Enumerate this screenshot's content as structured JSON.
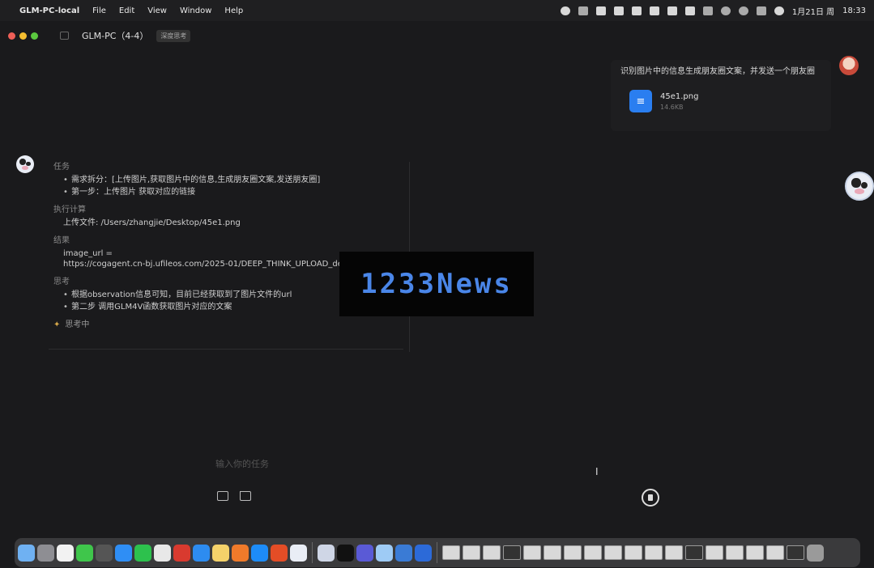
{
  "menubar": {
    "app_name": "GLM-PC-local",
    "menus": [
      "File",
      "Edit",
      "View",
      "Window",
      "Help"
    ],
    "date": "1月21日 周",
    "time": "18:33"
  },
  "window": {
    "title": "GLM-PC（4-4）",
    "badge": "深度思考"
  },
  "user_message": {
    "text": "识别图片中的信息生成朋友圈文案，并发送一个朋友圈",
    "attachment": {
      "name": "45e1.png",
      "size": "14.6KB"
    }
  },
  "assistant": {
    "sections": [
      {
        "heading": "任务",
        "bullets": [
          "需求拆分：[上传图片,获取图片中的信息,生成朋友圈文案,发送朋友圈]",
          "第一步：上传图片 获取对应的链接"
        ]
      },
      {
        "heading": "执行计算",
        "text": "上传文件: /Users/zhangjie/Desktop/45e1.png"
      },
      {
        "heading": "结果",
        "lines": [
          "image_url =",
          "https://cogagent.cn-bj.ufileos.com/2025-01/DEEP_THINK_UPLOAD_de5"
        ]
      },
      {
        "heading": "思考",
        "bullets": [
          "根据observation信息可知，目前已经获取到了图片文件的url",
          "第二步 调用GLM4V函数获取图片对应的文案"
        ]
      }
    ],
    "status": "思考中"
  },
  "watermark": "1233News",
  "input": {
    "placeholder": "输入你的任务"
  },
  "colors": {
    "accent": "#2a7ef0",
    "watermark": "#4a86e8"
  }
}
